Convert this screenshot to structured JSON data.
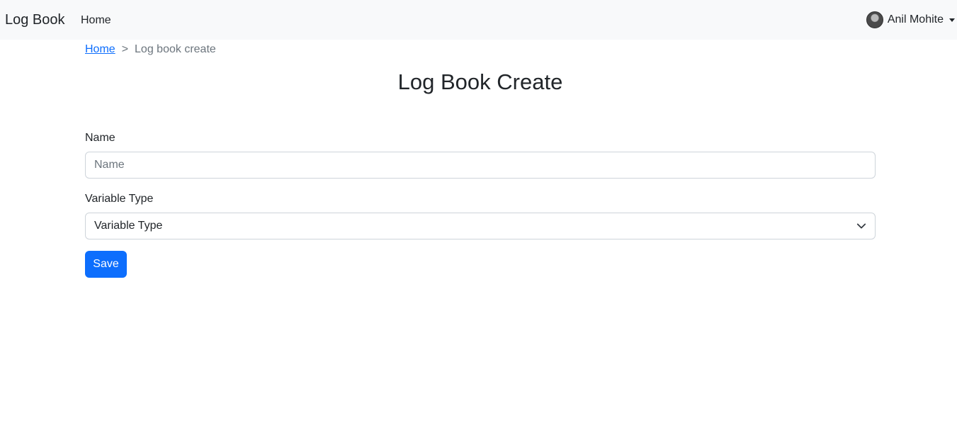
{
  "navbar": {
    "brand": "Log Book",
    "home_link": "Home",
    "user": {
      "name": "Anil Mohite",
      "avatar_icon": "user-avatar-icon",
      "caret_icon": "caret-down-icon"
    }
  },
  "breadcrumb": {
    "home": "Home",
    "separator": ">",
    "current": "Log book create"
  },
  "page": {
    "title": "Log Book Create"
  },
  "form": {
    "name_label": "Name",
    "name_value": "",
    "name_placeholder": "Name",
    "variable_type_label": "Variable Type",
    "variable_type_selected": "Variable Type",
    "select_arrow_icon": "chevron-down-icon",
    "save_label": "Save"
  },
  "colors": {
    "navbar_bg": "#f8f9fa",
    "primary": "#0d6efd",
    "link": "#0d6efd",
    "muted": "#6c757d",
    "border": "#ced4da"
  }
}
